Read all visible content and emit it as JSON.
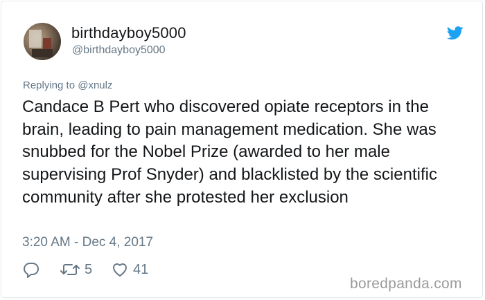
{
  "tweet": {
    "display_name": "birthdayboy5000",
    "handle": "@birthdayboy5000",
    "replying_to": "Replying to @xnulz",
    "text": "Candace B Pert who discovered opiate receptors in the brain, leading to pain management medication. She was snubbed for the Nobel Prize (awarded to her male supervising Prof Snyder) and blacklisted by the scientific community after she protested her exclusion",
    "timestamp": "3:20 AM - Dec 4, 2017",
    "retweets": "5",
    "likes": "41"
  },
  "icons": {
    "logo": "twitter-bird-icon",
    "reply": "reply-icon",
    "retweet": "retweet-icon",
    "like": "heart-icon"
  },
  "colors": {
    "twitter_blue": "#1da1f2",
    "text_primary": "#14171a",
    "text_secondary": "#657786",
    "border": "#e1e8ed",
    "watermark": "#9b9b9b"
  },
  "watermark": "boredpanda.com"
}
